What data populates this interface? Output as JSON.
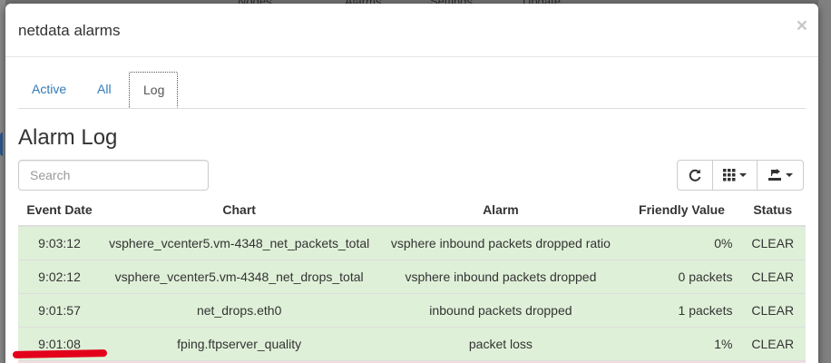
{
  "background": {
    "nav_items": [
      "Nodes",
      "Alarms",
      "Settings",
      "Update"
    ]
  },
  "modal": {
    "title": "netdata alarms",
    "close_label": "×"
  },
  "tabs": [
    {
      "label": "Active",
      "active": false
    },
    {
      "label": "All",
      "active": false
    },
    {
      "label": "Log",
      "active": true
    }
  ],
  "alarm_log": {
    "title": "Alarm Log",
    "search_placeholder": "Search",
    "toolbar": {
      "refresh_icon": "refresh-icon",
      "columns_icon": "columns-grid-icon",
      "export_icon": "export-icon"
    },
    "columns": [
      "Event Date",
      "Chart",
      "Alarm",
      "Friendly Value",
      "Status"
    ],
    "rows": [
      {
        "event_date": "9:03:12",
        "chart": "vsphere_vcenter5.vm-4348_net_packets_total",
        "alarm": "vsphere inbound packets dropped ratio",
        "value": "0%",
        "status": "CLEAR"
      },
      {
        "event_date": "9:02:12",
        "chart": "vsphere_vcenter5.vm-4348_net_drops_total",
        "alarm": "vsphere inbound packets dropped",
        "value": "0 packets",
        "status": "CLEAR"
      },
      {
        "event_date": "9:01:57",
        "chart": "net_drops.eth0",
        "alarm": "inbound packets dropped",
        "value": "1 packets",
        "status": "CLEAR"
      },
      {
        "event_date": "9:01:08",
        "chart": "fping.ftpserver_quality",
        "alarm": "packet loss",
        "value": "1%",
        "status": "CLEAR"
      }
    ]
  },
  "colors": {
    "row_clear": "#dff0d8",
    "row_warning": "#f2dede",
    "link": "#337ab7"
  }
}
